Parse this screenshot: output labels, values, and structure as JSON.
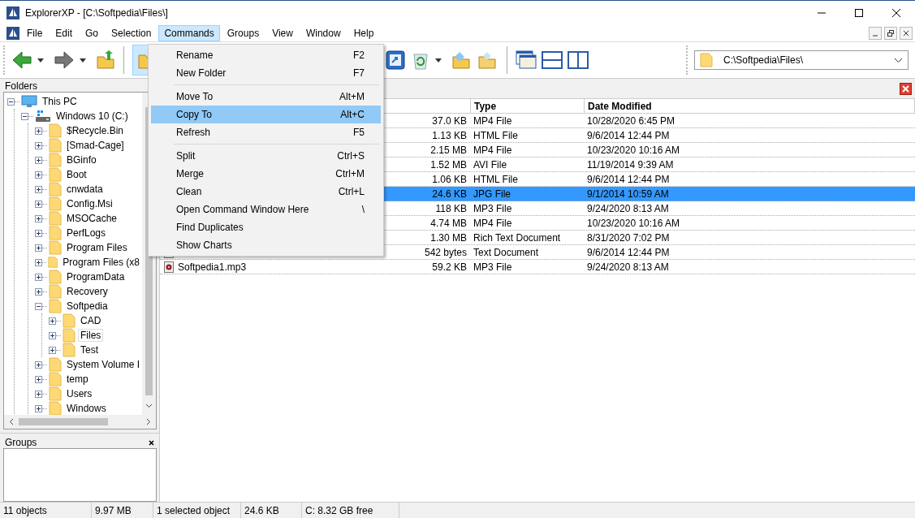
{
  "window": {
    "title": "ExplorerXP - [C:\\Softpedia\\Files\\]"
  },
  "menu_bar": [
    {
      "label": "File",
      "selected": false
    },
    {
      "label": "Edit",
      "selected": false
    },
    {
      "label": "Go",
      "selected": false
    },
    {
      "label": "Selection",
      "selected": false
    },
    {
      "label": "Commands",
      "selected": true
    },
    {
      "label": "Groups",
      "selected": false
    },
    {
      "label": "View",
      "selected": false
    },
    {
      "label": "Window",
      "selected": false
    },
    {
      "label": "Help",
      "selected": false
    }
  ],
  "commands_menu": {
    "groups": [
      [
        {
          "label": "Rename",
          "shortcut": "F2",
          "selected": false
        },
        {
          "label": "New Folder",
          "shortcut": "F7",
          "selected": false
        }
      ],
      [
        {
          "label": "Move To",
          "shortcut": "Alt+M",
          "selected": false
        },
        {
          "label": "Copy To",
          "shortcut": "Alt+C",
          "selected": true
        },
        {
          "label": "Refresh",
          "shortcut": "F5",
          "selected": false
        }
      ],
      [
        {
          "label": "Split",
          "shortcut": "Ctrl+S",
          "selected": false
        },
        {
          "label": "Merge",
          "shortcut": "Ctrl+M",
          "selected": false
        },
        {
          "label": "Clean",
          "shortcut": "Ctrl+L",
          "selected": false
        },
        {
          "label": "Open Command Window Here",
          "shortcut": "\\",
          "selected": false
        },
        {
          "label": "Find Duplicates",
          "selected": false
        },
        {
          "label": "Show Charts",
          "selected": false
        }
      ]
    ]
  },
  "address": {
    "value": "C:\\Softpedia\\Files\\"
  },
  "folders_pane": {
    "title": "Folders",
    "tree": [
      {
        "label": "This PC",
        "kind": "pc",
        "expanded": true,
        "selected": false,
        "children": [
          {
            "label": "Windows 10 (C:)",
            "kind": "drive",
            "expanded": true,
            "selected": false,
            "children": [
              {
                "label": "$Recycle.Bin",
                "kind": "folder",
                "expanded": false,
                "selected": false
              },
              {
                "label": "[Smad-Cage]",
                "kind": "folder",
                "expanded": false,
                "selected": false
              },
              {
                "label": "BGinfo",
                "kind": "folder",
                "expanded": false,
                "selected": false
              },
              {
                "label": "Boot",
                "kind": "folder",
                "expanded": false,
                "selected": false
              },
              {
                "label": "cnwdata",
                "kind": "folder",
                "expanded": false,
                "selected": false
              },
              {
                "label": "Config.Msi",
                "kind": "folder",
                "expanded": false,
                "selected": false
              },
              {
                "label": "MSOCache",
                "kind": "folder",
                "expanded": false,
                "selected": false
              },
              {
                "label": "PerfLogs",
                "kind": "folder",
                "expanded": false,
                "selected": false
              },
              {
                "label": "Program Files",
                "kind": "folder",
                "expanded": false,
                "selected": false
              },
              {
                "label": "Program Files (x8",
                "kind": "folder",
                "expanded": false,
                "selected": false
              },
              {
                "label": "ProgramData",
                "kind": "folder",
                "expanded": false,
                "selected": false
              },
              {
                "label": "Recovery",
                "kind": "folder",
                "expanded": false,
                "selected": false
              },
              {
                "label": "Softpedia",
                "kind": "folder",
                "expanded": true,
                "selected": false,
                "children": [
                  {
                    "label": "CAD",
                    "kind": "folder",
                    "expanded": false,
                    "selected": false
                  },
                  {
                    "label": "Files",
                    "kind": "folder",
                    "expanded": false,
                    "selected": true
                  },
                  {
                    "label": "Test",
                    "kind": "folder",
                    "expanded": false,
                    "selected": false
                  }
                ]
              },
              {
                "label": "System Volume I",
                "kind": "folder",
                "expanded": false,
                "selected": false
              },
              {
                "label": "temp",
                "kind": "folder",
                "expanded": false,
                "selected": false
              },
              {
                "label": "Users",
                "kind": "folder",
                "expanded": false,
                "selected": false
              },
              {
                "label": "Windows",
                "kind": "folder",
                "expanded": false,
                "selected": false
              }
            ]
          }
        ]
      }
    ]
  },
  "groups_pane": {
    "title": "Groups"
  },
  "file_list": {
    "columns": [
      "Type",
      "Date Modified"
    ],
    "rows": [
      {
        "size": "37.0 KB",
        "type": "MP4 File",
        "date": "10/28/2020 6:45 PM",
        "selected": false
      },
      {
        "size": "1.13 KB",
        "type": "HTML File",
        "date": "9/6/2014 12:44 PM",
        "selected": false
      },
      {
        "size": "2.15 MB",
        "type": "MP4 File",
        "date": "10/23/2020 10:16 AM",
        "selected": false
      },
      {
        "size": "1.52 MB",
        "type": "AVI File",
        "date": "11/19/2014 9:39 AM",
        "selected": false
      },
      {
        "size": "1.06 KB",
        "type": "HTML File",
        "date": "9/6/2014 12:44 PM",
        "selected": false
      },
      {
        "size": "24.6 KB",
        "type": "JPG File",
        "date": "9/1/2014 10:59 AM",
        "selected": true
      },
      {
        "size": "118 KB",
        "type": "MP3 File",
        "date": "9/24/2020 8:13 AM",
        "selected": false
      },
      {
        "size": "4.74 MB",
        "type": "MP4 File",
        "date": "10/23/2020 10:16 AM",
        "selected": false
      },
      {
        "size": "1.30 MB",
        "type": "Rich Text Document",
        "date": "8/31/2020 7:02 PM",
        "selected": false
      },
      {
        "kind": "text",
        "size": "542 bytes",
        "type": "Text Document",
        "date": "9/6/2014 12:44 PM",
        "selected": false
      },
      {
        "kind": "audio",
        "name": "Softpedia1.mp3",
        "size": "59.2 KB",
        "type": "MP3 File",
        "date": "9/24/2020 8:13 AM",
        "selected": false
      }
    ]
  },
  "status_bar": [
    "11 objects",
    "9.97 MB",
    "1 selected object",
    "24.6 KB",
    "C: 8.32 GB free"
  ]
}
